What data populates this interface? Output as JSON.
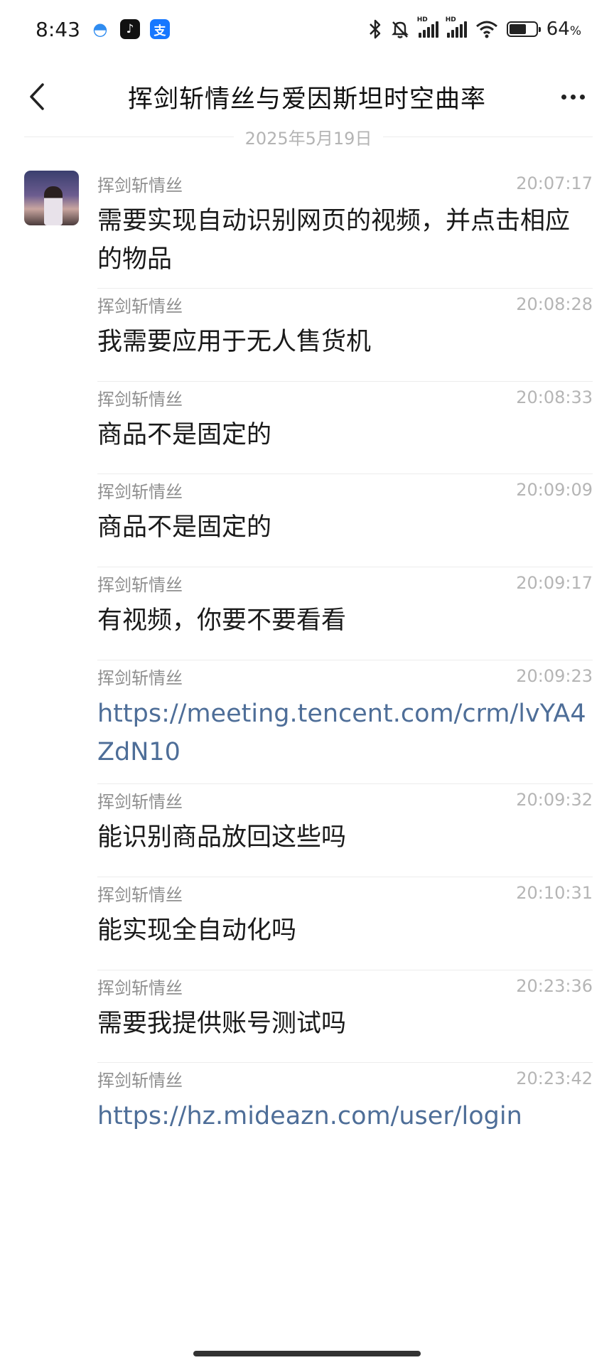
{
  "status_bar": {
    "time": "8:43",
    "app_icons": [
      "chat-bubble-icon",
      "tiktok-icon",
      "alipay-icon"
    ],
    "alipay_glyph": "支",
    "tiktok_glyph": "♪",
    "chat_glyph": "◓",
    "bluetooth_glyph": "✱",
    "mute_glyph": "🔕",
    "signal_label": "HD",
    "wifi_glyph": "◠",
    "battery_level": 64,
    "battery_pct": "64",
    "battery_unit": "%"
  },
  "nav": {
    "title": "挥剑斩情丝与爱因斯坦时空曲率"
  },
  "date_separator": "2025年5月19日",
  "messages": [
    {
      "sender": "挥剑斩情丝",
      "time": "20:07:17",
      "text": "需要实现自动识别网页的视频，并点击相应的物品",
      "is_link": false
    },
    {
      "sender": "挥剑斩情丝",
      "time": "20:08:28",
      "text": "我需要应用于无人售货机",
      "is_link": false
    },
    {
      "sender": "挥剑斩情丝",
      "time": "20:08:33",
      "text": "商品不是固定的",
      "is_link": false
    },
    {
      "sender": "挥剑斩情丝",
      "time": "20:09:09",
      "text": "商品不是固定的",
      "is_link": false
    },
    {
      "sender": "挥剑斩情丝",
      "time": "20:09:17",
      "text": "有视频，你要不要看看",
      "is_link": false
    },
    {
      "sender": "挥剑斩情丝",
      "time": "20:09:23",
      "text": "https://meeting.tencent.com/crm/lvYA4ZdN10",
      "is_link": true
    },
    {
      "sender": "挥剑斩情丝",
      "time": "20:09:32",
      "text": "能识别商品放回这些吗",
      "is_link": false
    },
    {
      "sender": "挥剑斩情丝",
      "time": "20:10:31",
      "text": "能实现全自动化吗",
      "is_link": false
    },
    {
      "sender": "挥剑斩情丝",
      "time": "20:23:36",
      "text": "需要我提供账号测试吗",
      "is_link": false
    },
    {
      "sender": "挥剑斩情丝",
      "time": "20:23:42",
      "text": "https://hz.mideazn.com/user/login",
      "is_link": true
    }
  ],
  "colors": {
    "link": "#4e6e98",
    "sender": "#8f8f8f",
    "time": "#b5b5b5",
    "divider": "#ececec",
    "background": "#ffffff"
  }
}
